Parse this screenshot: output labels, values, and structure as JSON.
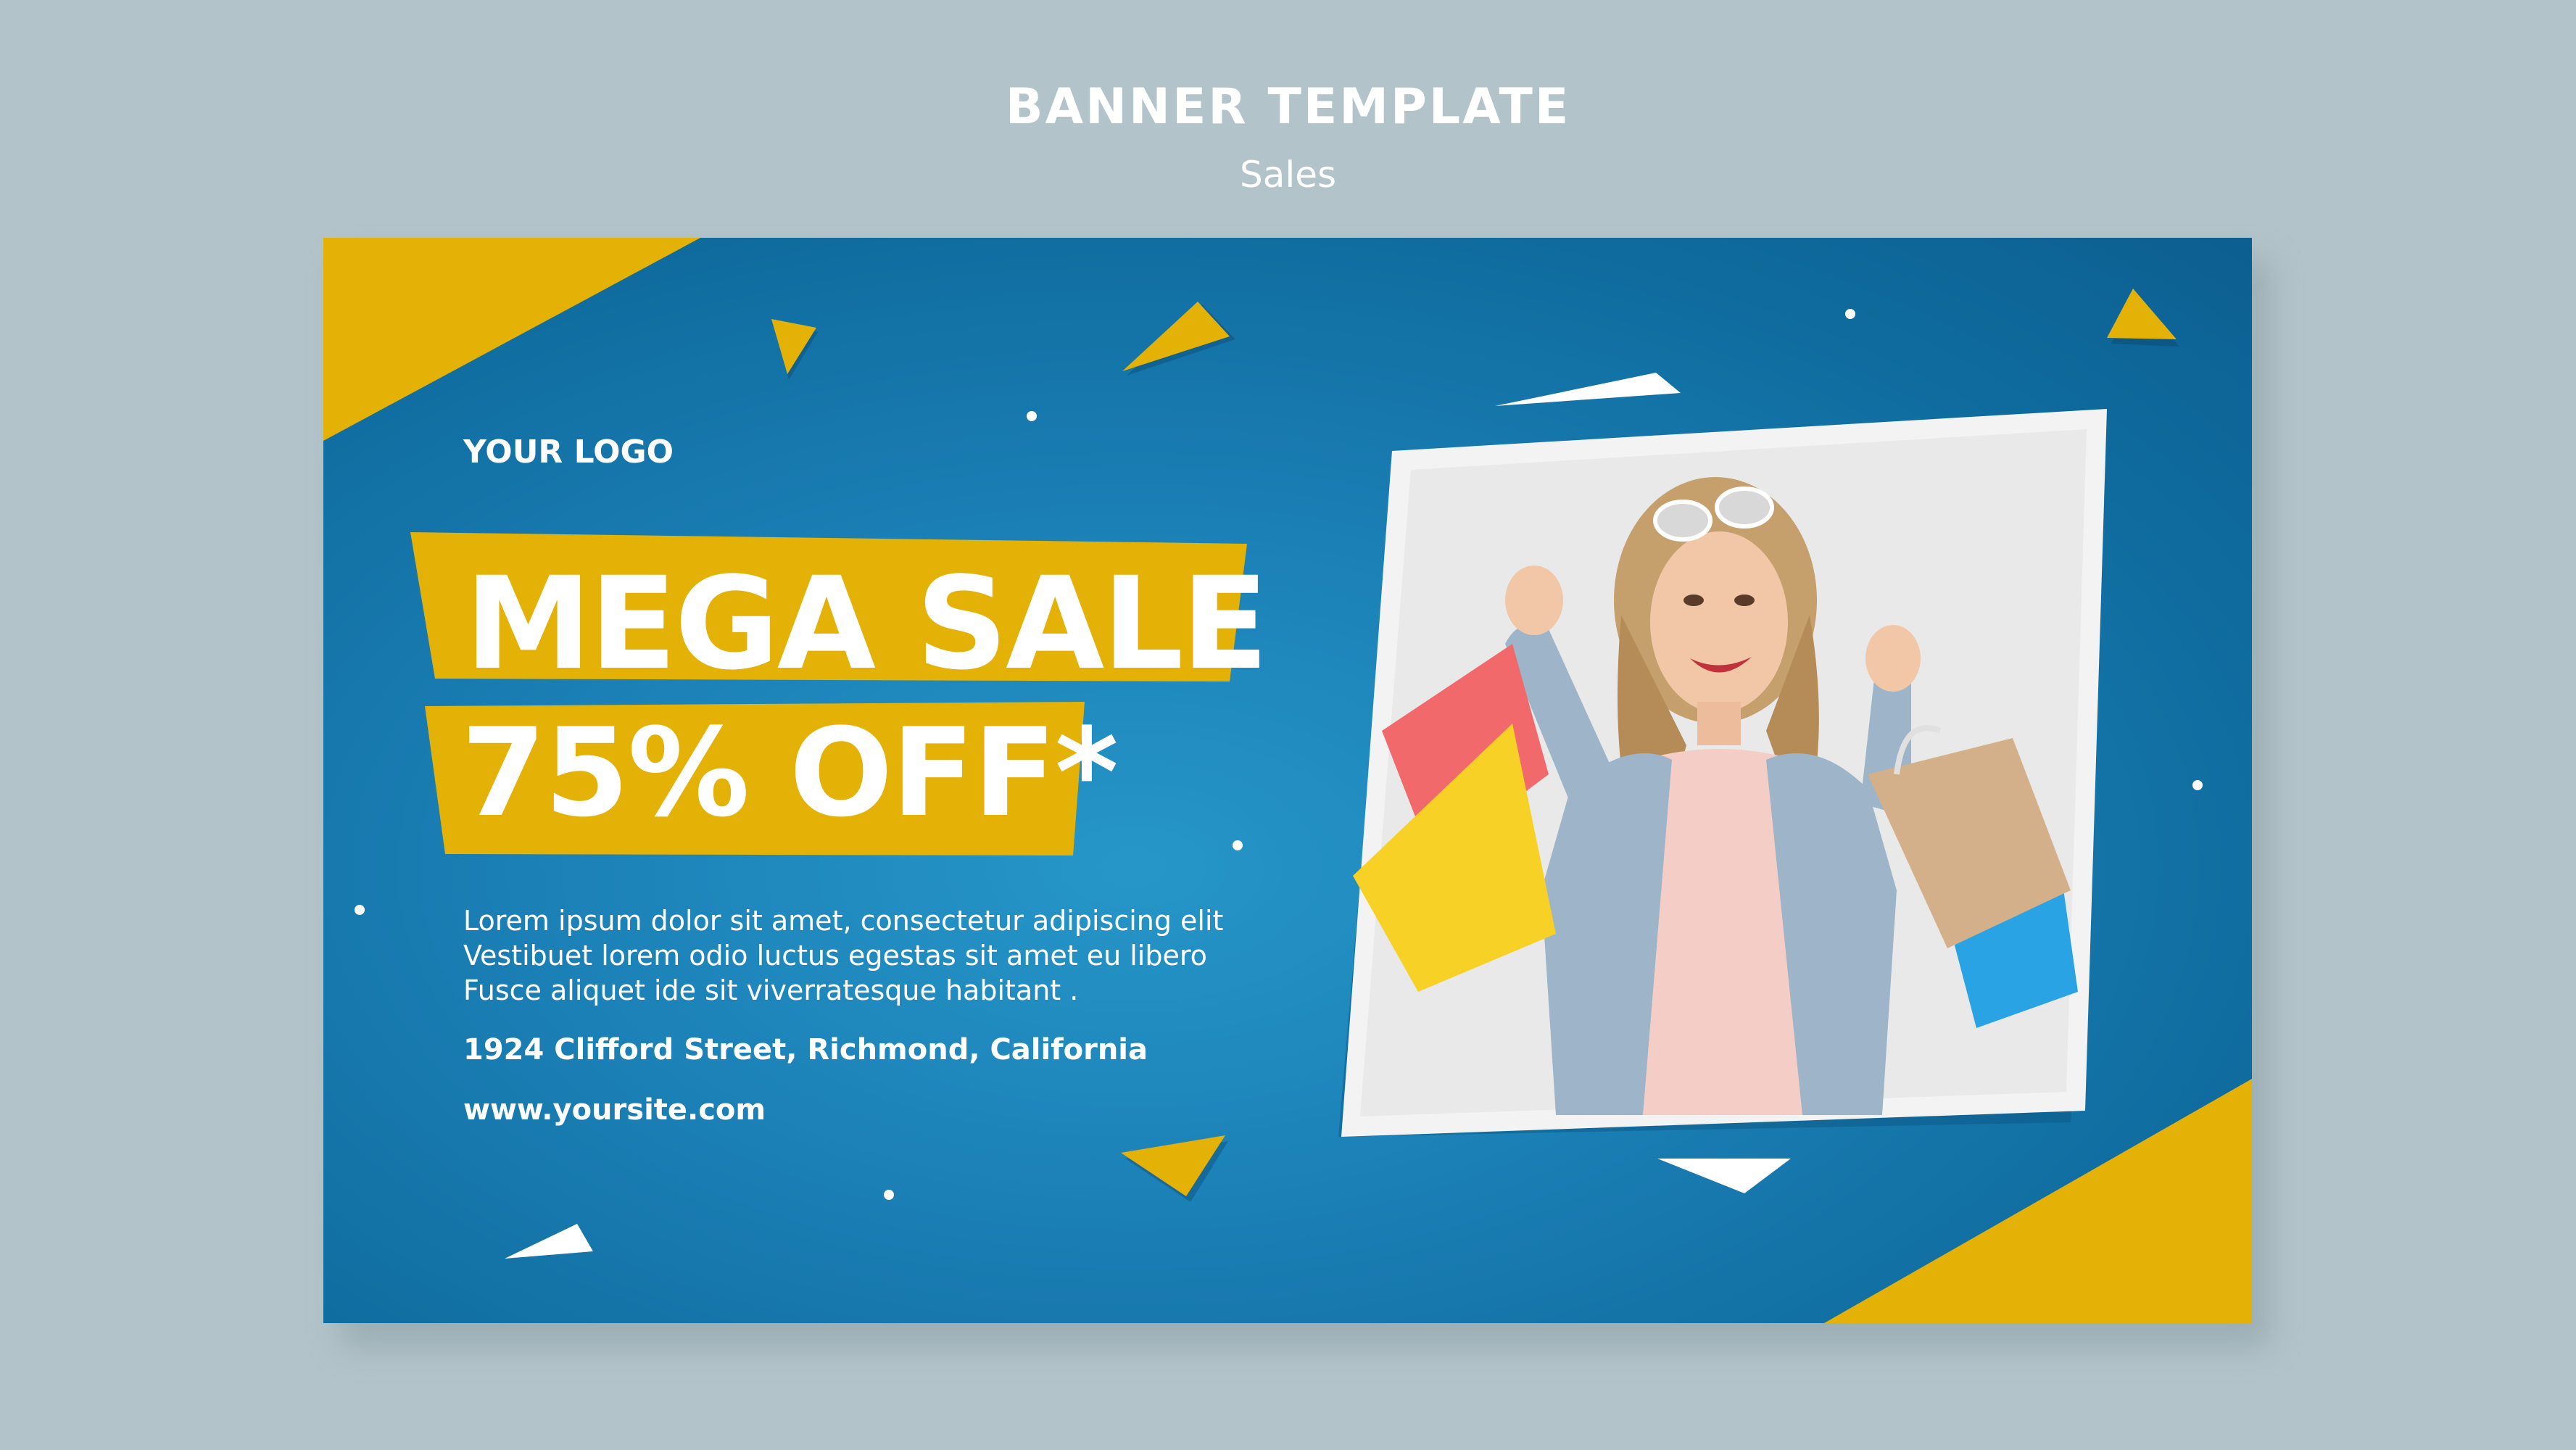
{
  "header": {
    "title": "BANNER TEMPLATE",
    "subtitle": "Sales"
  },
  "banner": {
    "logo": "YOUR LOGO",
    "headline_line1": "MEGA SALE",
    "headline_line2": "75% OFF*",
    "body_lines": [
      "Lorem ipsum dolor sit amet, consectetur adipiscing elit",
      "Vestibuet lorem odio luctus egestas sit amet eu libero",
      "Fusce aliquet ide sit viverratesque habitant ."
    ],
    "address": "1924  Clifford Street, Richmond, California",
    "website": "www.yoursite.com"
  },
  "colors": {
    "page_background": "#b2c3c9",
    "banner_blue": "#1c82b8",
    "accent_yellow": "#e4b106",
    "white": "#ffffff"
  },
  "icons": {
    "photo": "woman-with-shopping-bags-photo"
  }
}
